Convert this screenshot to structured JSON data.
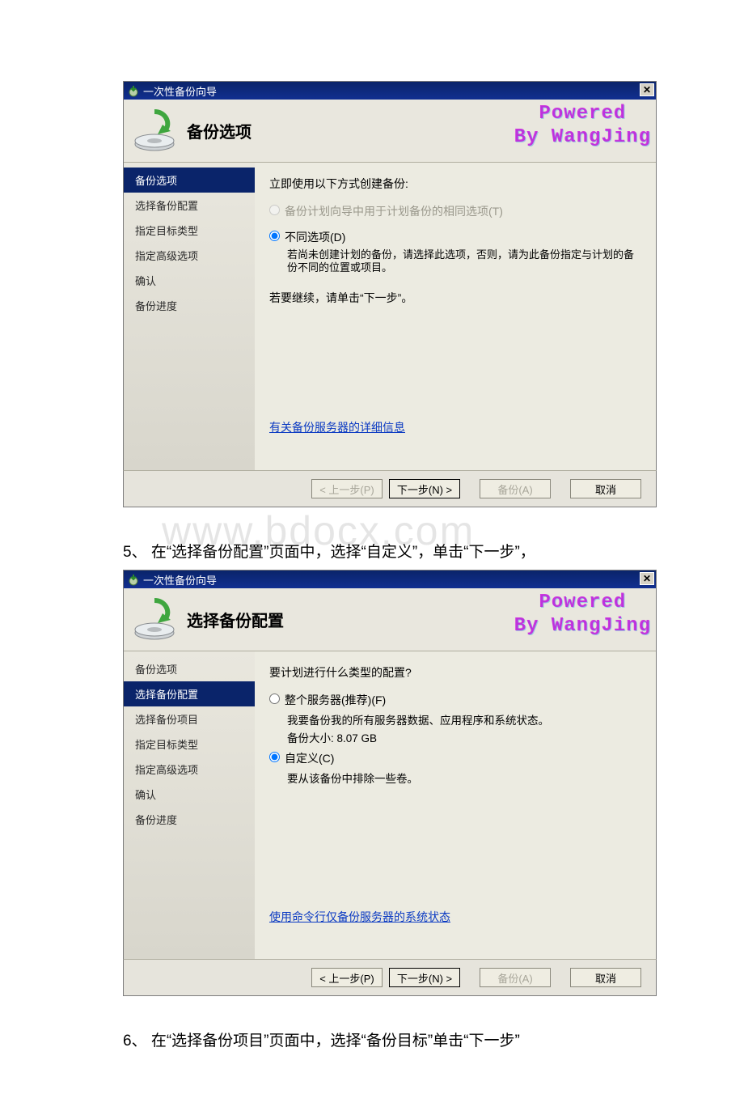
{
  "watermark": "www.bdocx.com",
  "powered": {
    "line1": "Powered",
    "line2": "By WangJing"
  },
  "wizard1": {
    "title": "一次性备份向导",
    "header_title": "备份选项",
    "steps": [
      "备份选项",
      "选择备份配置",
      "指定目标类型",
      "指定高级选项",
      "确认",
      "备份进度"
    ],
    "active_step_index": 0,
    "intro": "立即使用以下方式创建备份:",
    "radio1": {
      "label": "备份计划向导中用于计划备份的相同选项(T)",
      "enabled": false,
      "checked": false
    },
    "radio2": {
      "label": "不同选项(D)",
      "desc": "若尚未创建计划的备份，请选择此选项，否则，请为此备份指定与计划的备份不同的位置或项目。",
      "enabled": true,
      "checked": true
    },
    "continue_text": "若要继续，请单击“下一步”。",
    "link": "有关备份服务器的详细信息",
    "buttons": {
      "prev": "< 上一步(P)",
      "next": "下一步(N) >",
      "backup": "备份(A)",
      "cancel": "取消"
    },
    "buttons_state": {
      "prev_enabled": false,
      "next_enabled": true,
      "backup_enabled": false,
      "cancel_enabled": true
    }
  },
  "instruction5": "5、 在“选择备份配置”页面中，选择“自定义”，单击“下一步”，",
  "wizard2": {
    "title": "一次性备份向导",
    "header_title": "选择备份配置",
    "steps": [
      "备份选项",
      "选择备份配置",
      "选择备份项目",
      "指定目标类型",
      "指定高级选项",
      "确认",
      "备份进度"
    ],
    "active_step_index": 1,
    "intro": "要计划进行什么类型的配置?",
    "radio1": {
      "label": "整个服务器(推荐)(F)",
      "desc1": "我要备份我的所有服务器数据、应用程序和系统状态。",
      "desc2": "备份大小: 8.07 GB",
      "checked": false
    },
    "radio2": {
      "label": "自定义(C)",
      "desc": "要从该备份中排除一些卷。",
      "checked": true
    },
    "link": "使用命令行仅备份服务器的系统状态",
    "buttons": {
      "prev": "< 上一步(P)",
      "next": "下一步(N) >",
      "backup": "备份(A)",
      "cancel": "取消"
    },
    "buttons_state": {
      "prev_enabled": true,
      "next_enabled": true,
      "backup_enabled": false,
      "cancel_enabled": true
    }
  },
  "instruction6": "6、 在“选择备份项目”页面中，选择“备份目标”单击“下一步”"
}
